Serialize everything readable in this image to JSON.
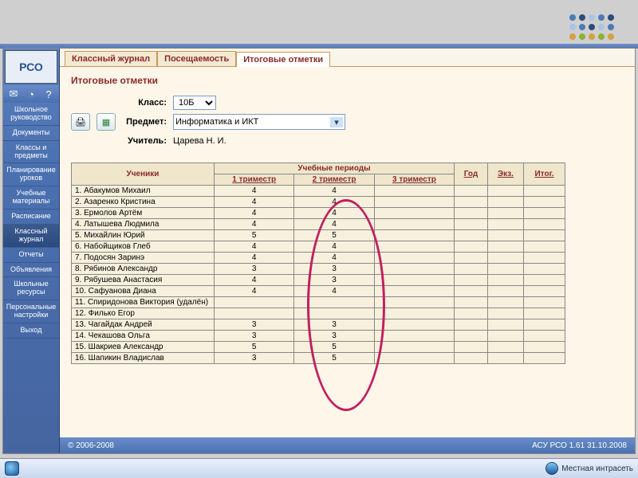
{
  "tabs": {
    "t1": "Классный журнал",
    "t2": "Посещаемость",
    "t3": "Итоговые отметки"
  },
  "page_title": "Итоговые отметки",
  "sidebar": {
    "logo": "РСО",
    "items": [
      "Школьное руководство",
      "Документы",
      "Классы и предметы",
      "Планирование уроков",
      "Учебные материалы",
      "Расписание",
      "Классный журнал",
      "Отчеты",
      "Объявления",
      "Школьные ресурсы",
      "Персональные настройки",
      "Выход"
    ]
  },
  "filters": {
    "class_label": "Класс:",
    "class_value": "10Б",
    "subject_label": "Предмет:",
    "subject_value": "Информатика и ИКТ",
    "teacher_label": "Учитель:",
    "teacher_value": "Царева Н. И."
  },
  "tbl": {
    "students_hdr": "Ученики",
    "periods_hdr": "Учебные периоды",
    "p1": "1 триместр",
    "p2": "2 триместр",
    "p3": "3 триместр",
    "year": "Год",
    "exam": "Экз.",
    "final": "Итог."
  },
  "rows": [
    {
      "n": "1",
      "name": "Абакумов Михаил",
      "g1": "4",
      "g2": "4"
    },
    {
      "n": "2",
      "name": "Азаренко Кристина",
      "g1": "4",
      "g2": "4"
    },
    {
      "n": "3",
      "name": "Ермолов Артём",
      "g1": "4",
      "g2": "4"
    },
    {
      "n": "4",
      "name": "Латышева Людмила",
      "g1": "4",
      "g2": "4"
    },
    {
      "n": "5",
      "name": "Михайлин Юрий",
      "g1": "5",
      "g2": "5"
    },
    {
      "n": "6",
      "name": "Набойщиков Глеб",
      "g1": "4",
      "g2": "4"
    },
    {
      "n": "7",
      "name": "Подосян Заринэ",
      "g1": "4",
      "g2": "4"
    },
    {
      "n": "8",
      "name": "Рябинов Александр",
      "g1": "3",
      "g2": "3"
    },
    {
      "n": "9",
      "name": "Рябушева Анастасия",
      "g1": "4",
      "g2": "3"
    },
    {
      "n": "10",
      "name": "Сафуанова Диана",
      "g1": "4",
      "g2": "4"
    },
    {
      "n": "11",
      "name": "Спиридонова Виктория (удалён)",
      "g1": "",
      "g2": ""
    },
    {
      "n": "12",
      "name": "Филько Егор",
      "g1": "",
      "g2": ""
    },
    {
      "n": "13",
      "name": "Чагайдак Андрей",
      "g1": "3",
      "g2": "3"
    },
    {
      "n": "14",
      "name": "Чекашова Ольга",
      "g1": "3",
      "g2": "3"
    },
    {
      "n": "15",
      "name": "Шакриев Александр",
      "g1": "5",
      "g2": "5"
    },
    {
      "n": "16",
      "name": "Шапикин Владислав",
      "g1": "3",
      "g2": "5"
    }
  ],
  "footer": {
    "left": "© 2006-2008",
    "right": "АСУ РСО 1.61   31.10.2008"
  },
  "taskbar": {
    "zone": "Местная интрасеть"
  }
}
